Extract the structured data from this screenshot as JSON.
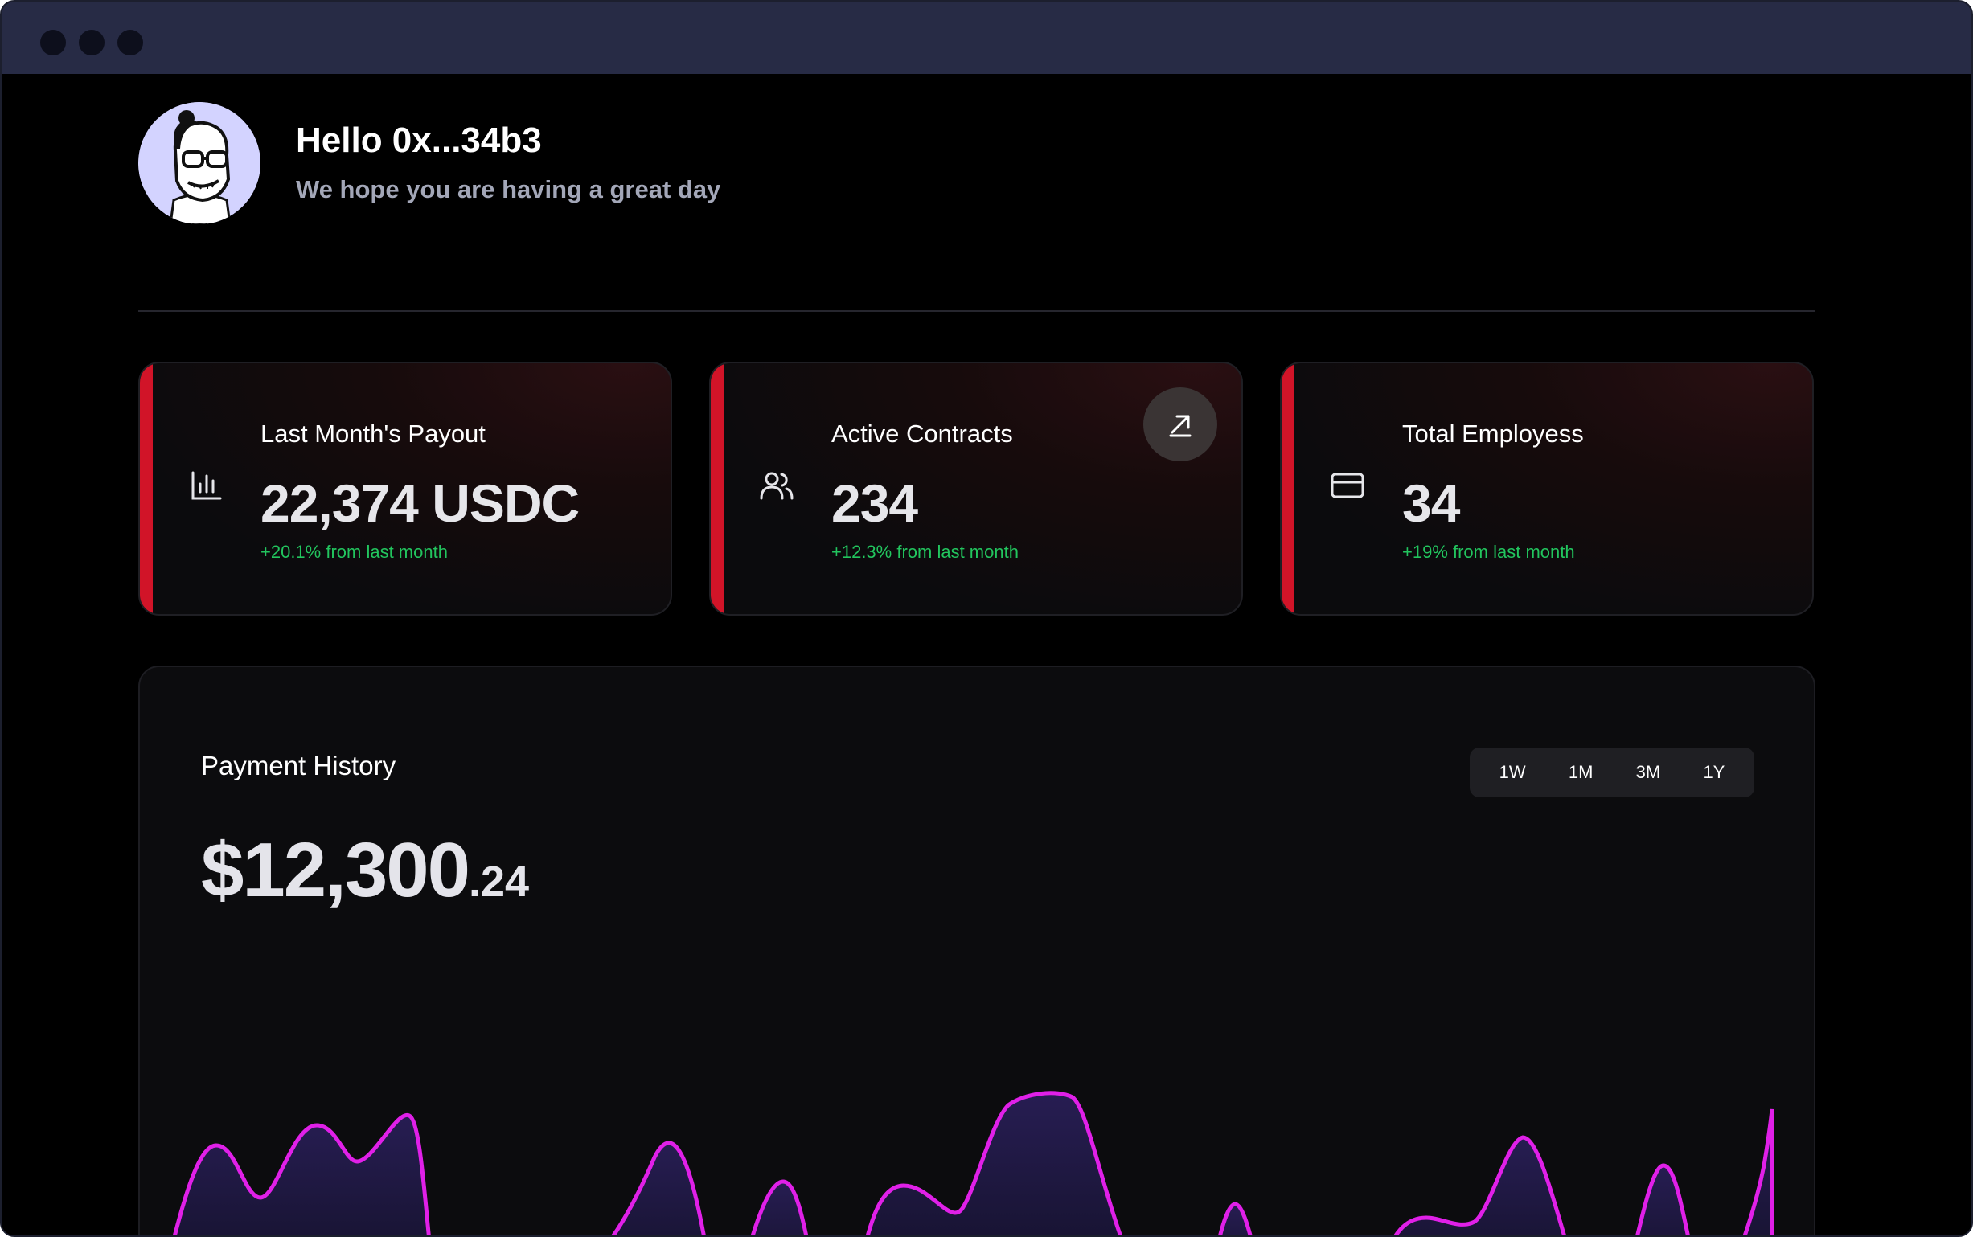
{
  "header": {
    "greeting": "Hello 0x...34b3",
    "subtitle": "We hope you are having a great day"
  },
  "cards": [
    {
      "label": "Last Month's Payout",
      "value": "22,374 USDC",
      "delta": "+20.1% from last month",
      "icon": "bar-chart-icon"
    },
    {
      "label": "Active Contracts",
      "value": "234",
      "delta": "+12.3% from last month",
      "icon": "users-icon"
    },
    {
      "label": "Total Employess",
      "value": "34",
      "delta": "+19% from last month",
      "icon": "credit-card-icon"
    }
  ],
  "payment_history": {
    "title": "Payment History",
    "amount_main": "$12,300",
    "amount_cents": ".24",
    "ranges": [
      "1W",
      "1M",
      "3M",
      "1Y"
    ]
  },
  "colors": {
    "accent_red": "#d11428",
    "delta_green": "#22c55e",
    "line_magenta": "#e020e8",
    "titlebar": "#272b45"
  }
}
